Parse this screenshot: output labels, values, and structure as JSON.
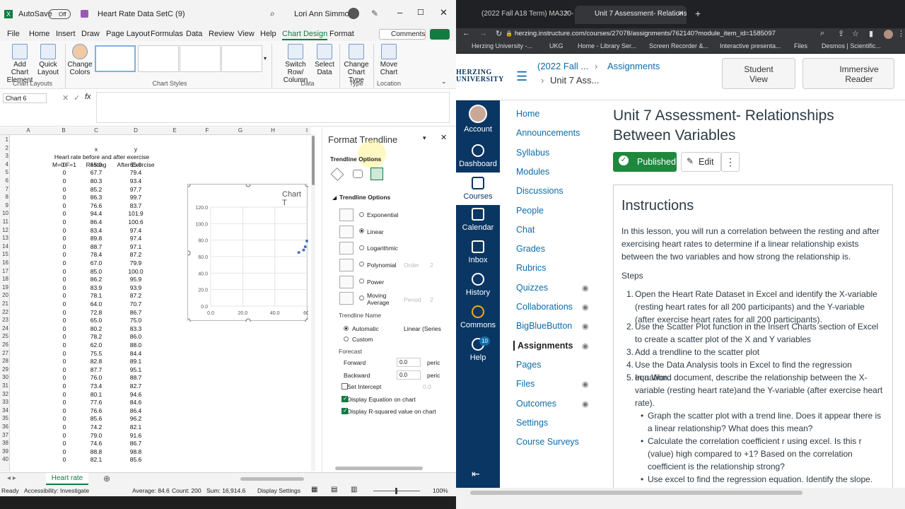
{
  "excel": {
    "title_bar": {
      "autosave_label": "AutoSave",
      "autosave_state": "Off",
      "file_name": "Heart Rate Data SetC (9)",
      "user_name": "Lori Ann Simmons"
    },
    "tabs": [
      "File",
      "Home",
      "Insert",
      "Draw",
      "Page Layout",
      "Formulas",
      "Data",
      "Review",
      "View",
      "Help",
      "Chart Design",
      "Format"
    ],
    "active_tab": "Chart Design",
    "comments_label": "Comments",
    "ribbon": {
      "add_chart_element": "Add Chart Element",
      "quick_layout": "Quick Layout",
      "change_colors": "Change Colors",
      "chart_layouts_label": "Chart Layouts",
      "chart_styles_label": "Chart Styles",
      "switch_row_column": "Switch Row/ Column",
      "select_data": "Select Data",
      "data_label": "Data",
      "change_chart_type": "Change Chart Type",
      "type_label": "Type",
      "move_chart": "Move Chart",
      "location_label": "Location"
    },
    "name_box": "Chart 6",
    "formula_value": "",
    "columns": [
      "A",
      "B",
      "C",
      "D",
      "E",
      "F",
      "G",
      "H",
      "I"
    ],
    "header_rows": {
      "row1_x": "x",
      "row1_y": "y",
      "row2": "Heart rate before and after exercise",
      "row3_b": "M=0 F=1",
      "row3_c": "Resting",
      "row3_d": "After Exercise"
    },
    "data_rows": [
      [
        "0",
        "55.0",
        "65.0"
      ],
      [
        "0",
        "67.7",
        "79.4"
      ],
      [
        "0",
        "80.3",
        "93.4"
      ],
      [
        "0",
        "85.2",
        "97.7"
      ],
      [
        "0",
        "86.3",
        "99.7"
      ],
      [
        "0",
        "76.6",
        "83.7"
      ],
      [
        "0",
        "94.4",
        "101.9"
      ],
      [
        "0",
        "86.4",
        "100.6"
      ],
      [
        "0",
        "83.4",
        "97.4"
      ],
      [
        "0",
        "89.8",
        "97.4"
      ],
      [
        "0",
        "88.7",
        "97.1"
      ],
      [
        "0",
        "78.4",
        "87.2"
      ],
      [
        "0",
        "67.0",
        "79.9"
      ],
      [
        "0",
        "85.0",
        "100.0"
      ],
      [
        "0",
        "86.2",
        "95.9"
      ],
      [
        "0",
        "83.9",
        "93.9"
      ],
      [
        "0",
        "78.1",
        "87.2"
      ],
      [
        "0",
        "64.0",
        "70.7"
      ],
      [
        "0",
        "72.8",
        "86.7"
      ],
      [
        "0",
        "65.0",
        "75.0"
      ],
      [
        "0",
        "80.2",
        "83.3"
      ],
      [
        "0",
        "78.2",
        "86.0"
      ],
      [
        "0",
        "62.0",
        "88.0"
      ],
      [
        "0",
        "75.5",
        "84.4"
      ],
      [
        "0",
        "82.8",
        "89.1"
      ],
      [
        "0",
        "87.7",
        "95.1"
      ],
      [
        "0",
        "76.0",
        "88.7"
      ],
      [
        "0",
        "73.4",
        "82.7"
      ],
      [
        "0",
        "80.1",
        "94.6"
      ],
      [
        "0",
        "77.6",
        "84.6"
      ],
      [
        "0",
        "76.6",
        "86.4"
      ],
      [
        "0",
        "85.6",
        "96.2"
      ],
      [
        "0",
        "74.2",
        "82.1"
      ],
      [
        "0",
        "79.0",
        "91.6"
      ],
      [
        "0",
        "74.6",
        "86.7"
      ],
      [
        "0",
        "88.8",
        "98.8"
      ],
      [
        "0",
        "82.1",
        "85.6"
      ]
    ],
    "chart": {
      "title": "Chart T"
    },
    "format_pane": {
      "title": "Format Trendline",
      "options_dropdown": "Trendline Options",
      "section": "Trendline Options",
      "types": [
        "Exponential",
        "Linear",
        "Logarithmic",
        "Polynomial",
        "Power",
        "Moving Average"
      ],
      "selected_type": "Linear",
      "order_label": "Order",
      "order_value": "2",
      "period_label": "Period",
      "period_value": "2",
      "name_label": "Trendline Name",
      "automatic": "Automatic",
      "automatic_value": "Linear (Series",
      "custom": "Custom",
      "forecast_label": "Forecast",
      "forward": "Forward",
      "forward_value": "0.0",
      "backward": "Backward",
      "backward_value": "0.0",
      "unit": "peric",
      "set_intercept": "Set Intercept",
      "intercept_value": "0.0",
      "display_equation": "Display Equation on chart",
      "display_r2": "Display R-squared value on chart"
    },
    "sheet_tab": "Heart rate",
    "status": {
      "ready": "Ready",
      "accessibility": "Accessibility: Investigate",
      "average": "Average: 84.6",
      "count": "Count: 200",
      "sum": "Sum: 16,914.6",
      "display_settings": "Display Settings",
      "zoom": "100%"
    }
  },
  "chart_data": {
    "type": "scatter",
    "title": "Chart T",
    "xlabel": "",
    "ylabel": "",
    "xlim": [
      0,
      60
    ],
    "ylim": [
      0,
      120
    ],
    "x_ticks": [
      "0.0",
      "20.0",
      "40.0",
      "60."
    ],
    "y_ticks": [
      "0.0",
      "20.0",
      "40.0",
      "60.0",
      "80.0",
      "100.0",
      "120.0"
    ],
    "points": [
      [
        55,
        65
      ],
      [
        58,
        68
      ],
      [
        59,
        72
      ],
      [
        60,
        79
      ]
    ]
  },
  "browser": {
    "tabs": [
      "(2022 Fall A18 Term) MA320-7D",
      "Unit 7 Assessment- Relationshi"
    ],
    "url": "herzing.instructure.com/courses/27078/assignments/762140?module_item_id=1585097",
    "bookmarks": [
      "Herzing University -...",
      "UKG",
      "Home - Library Ser...",
      "Screen Recorder &...",
      "Interactive presenta...",
      "Files",
      "Desmos | Scientific..."
    ],
    "logo": "HERZING UNIVERSITY",
    "breadcrumb": [
      "(2022 Fall ...",
      "Unit 7 Ass...",
      "Assignments"
    ],
    "student_view": "Student View",
    "immersive_reader": "Immersive Reader",
    "global_nav": [
      "Account",
      "Dashboard",
      "Courses",
      "Calendar",
      "Inbox",
      "History",
      "Commons",
      "Help"
    ],
    "help_badge": "10",
    "course_nav": [
      "Home",
      "Announcements",
      "Syllabus",
      "Modules",
      "Discussions",
      "People",
      "Chat",
      "Grades",
      "Rubrics",
      "Quizzes",
      "Collaborations",
      "BigBlueButton",
      "Assignments",
      "Pages",
      "Files",
      "Outcomes",
      "Settings",
      "Course Surveys"
    ],
    "active_course_nav": "Assignments",
    "page_title": "Unit 7 Assessment- Relationships Between Variables",
    "published": "Published",
    "edit": "Edit",
    "instructions_heading": "Instructions",
    "intro": "In this lesson, you will run a correlation between the resting and after exercising heart rates to determine if a linear relationship exists between the two variables and how strong the relationship is.",
    "steps_label": "Steps",
    "steps": [
      "Open the Heart Rate Dataset in Excel and identify the X-variable (resting heart rates for all 200 participants) and the Y-variable (after exercise heart rates for all 200 participants).",
      "Use the Scatter Plot function in the Insert Charts section of Excel to create a scatter plot of the X and Y variables",
      "Add a trendline to the scatter plot",
      "Use the Data Analysis tools in Excel to find the regression equation.",
      "In a Word document, describe the relationship between the X-variable (resting heart rate)and the Y-variable (after exercise heart rate)."
    ],
    "sub_steps": [
      "Graph the scatter plot with a trend line. Does it appear there is a linear relationship?  What does this mean?",
      "Calculate the correlation coefficient r using excel. Is this r (value) high compared to +1?  Based on the correlation coefficient is the relationship strong?",
      "Use excel to find the regression equation. Identify the slope."
    ]
  }
}
